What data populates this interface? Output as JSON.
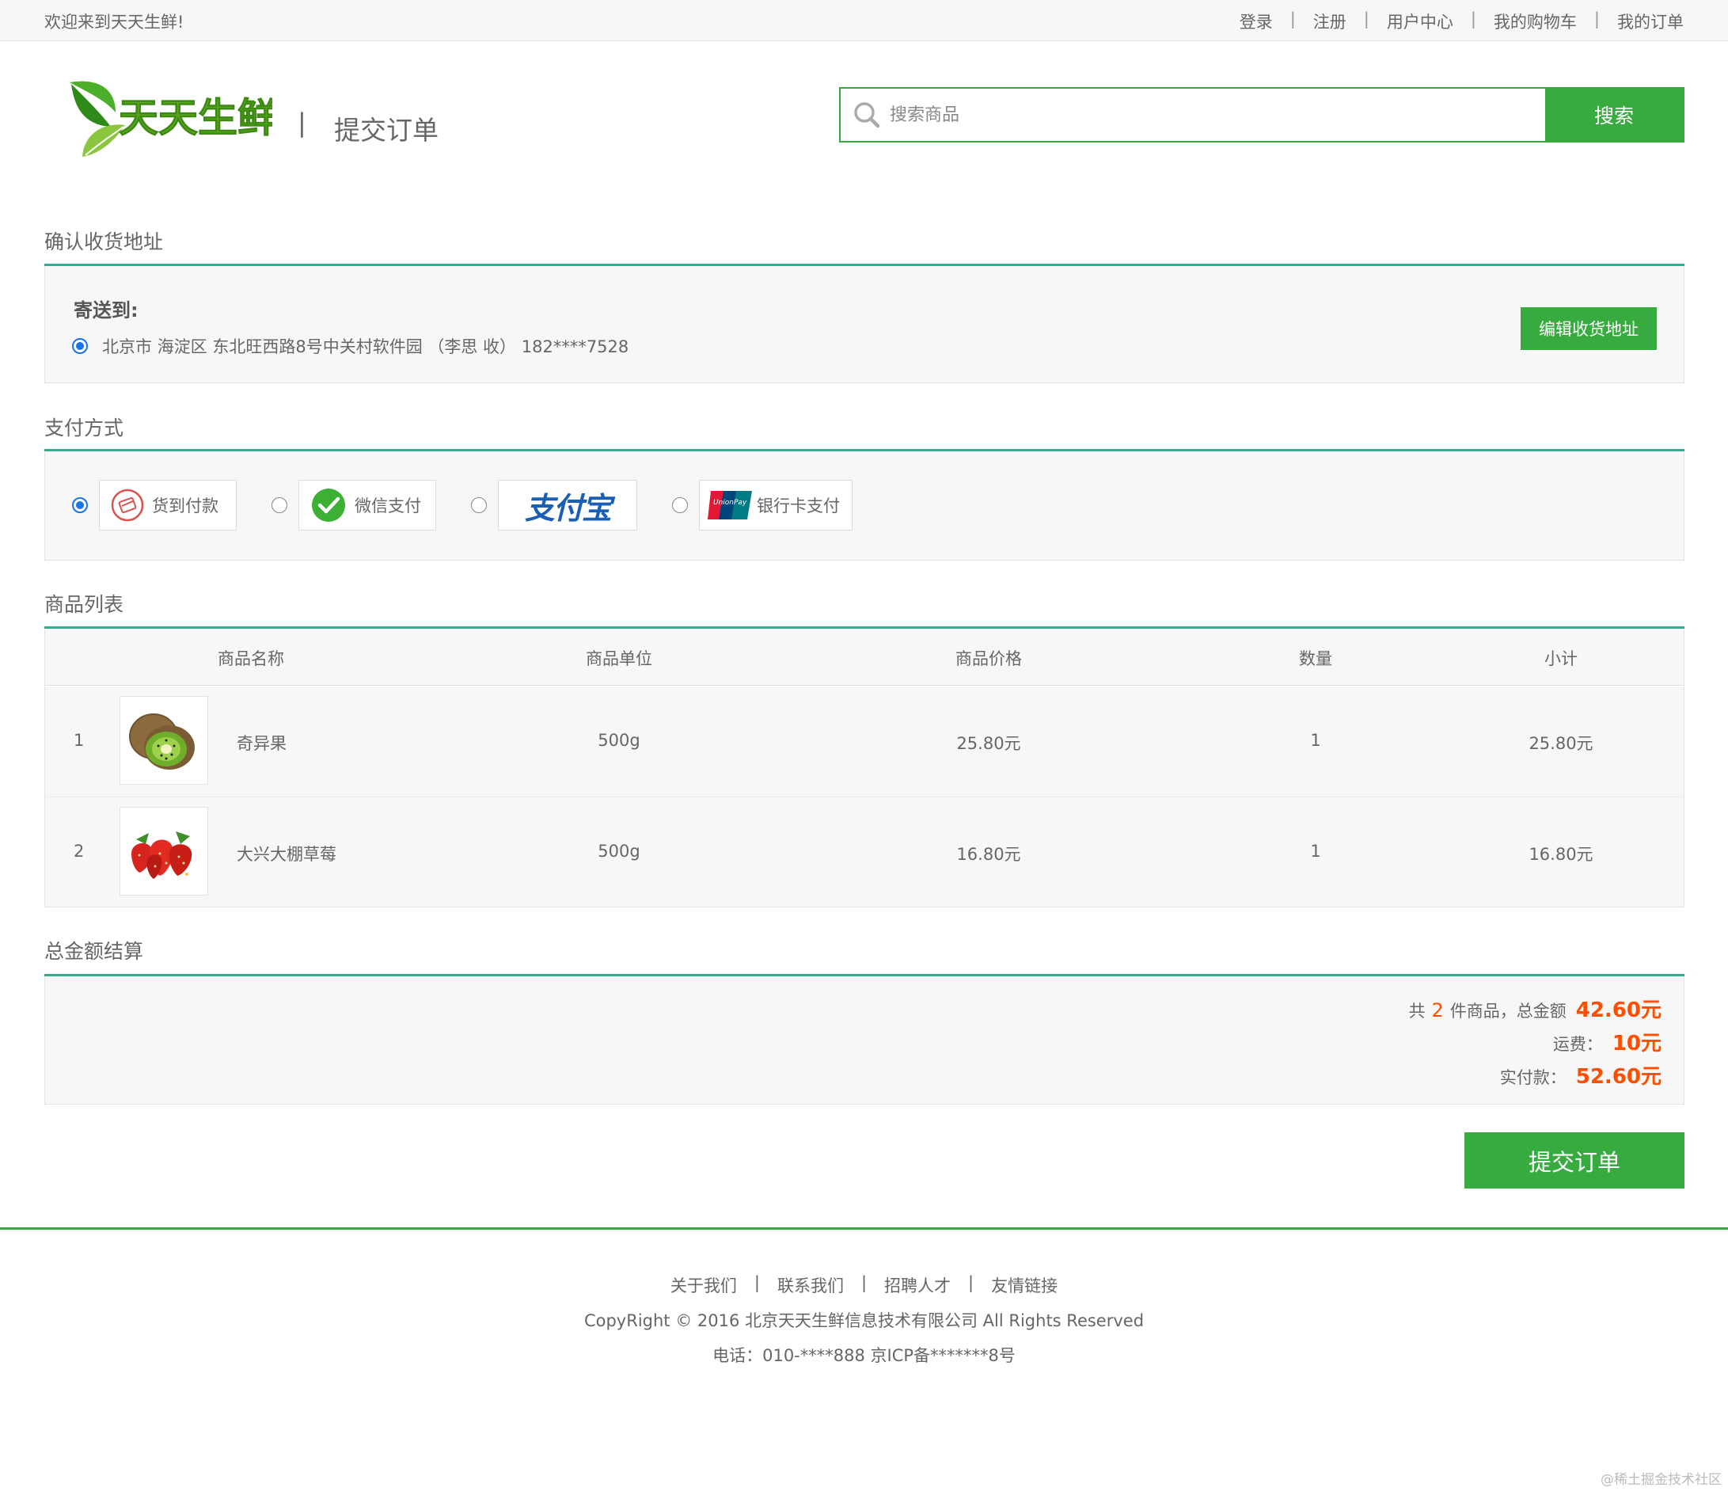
{
  "topbar": {
    "welcome": "欢迎来到天天生鲜!",
    "links": [
      "登录",
      "注册",
      "用户中心",
      "我的购物车",
      "我的订单"
    ],
    "separator": "|"
  },
  "header": {
    "logo_text": "天天生鲜",
    "separator": "|",
    "page_title": "提交订单",
    "search_placeholder": "搜索商品",
    "search_button": "搜索"
  },
  "address": {
    "section_title": "确认收货地址",
    "label": "寄送到:",
    "entry": "北京市 海淀区 东北旺西路8号中关村软件园 （李思 收） 182****7528",
    "edit_button": "编辑收货地址"
  },
  "payment": {
    "section_title": "支付方式",
    "options": [
      {
        "label": "货到付款",
        "selected": true
      },
      {
        "label": "微信支付",
        "selected": false
      },
      {
        "label": "支付宝",
        "selected": false
      },
      {
        "label": "银行卡支付",
        "selected": false
      }
    ],
    "unionpay_logo_text": "UnionPay 银联"
  },
  "products": {
    "section_title": "商品列表",
    "headers": [
      "商品名称",
      "商品单位",
      "商品价格",
      "数量",
      "小计"
    ],
    "rows": [
      {
        "index": "1",
        "name": "奇异果",
        "unit": "500g",
        "price": "25.80元",
        "qty": "1",
        "subtotal": "25.80元"
      },
      {
        "index": "2",
        "name": "大兴大棚草莓",
        "unit": "500g",
        "price": "16.80元",
        "qty": "1",
        "subtotal": "16.80元"
      }
    ]
  },
  "total": {
    "section_title": "总金额结算",
    "count_prefix": "共",
    "count": "2",
    "count_suffix": "件商品，总金额",
    "amount": "42.60元",
    "shipping_label": "运费：",
    "shipping": "10元",
    "paid_label": "实付款：",
    "paid": "52.60元"
  },
  "submit_button": "提交订单",
  "footer": {
    "links": [
      "关于我们",
      "联系我们",
      "招聘人才",
      "友情链接"
    ],
    "separator": "|",
    "copyright": "CopyRight © 2016 北京天天生鲜信息技术有限公司 All Rights Reserved",
    "tel": "电话：010-****888 京ICP备*******8号"
  },
  "watermark": "@稀土掘金技术社区",
  "colors": {
    "brand_green": "#37ab40",
    "accent_orange": "#ff4e00",
    "radio_blue": "#1b73e8"
  }
}
